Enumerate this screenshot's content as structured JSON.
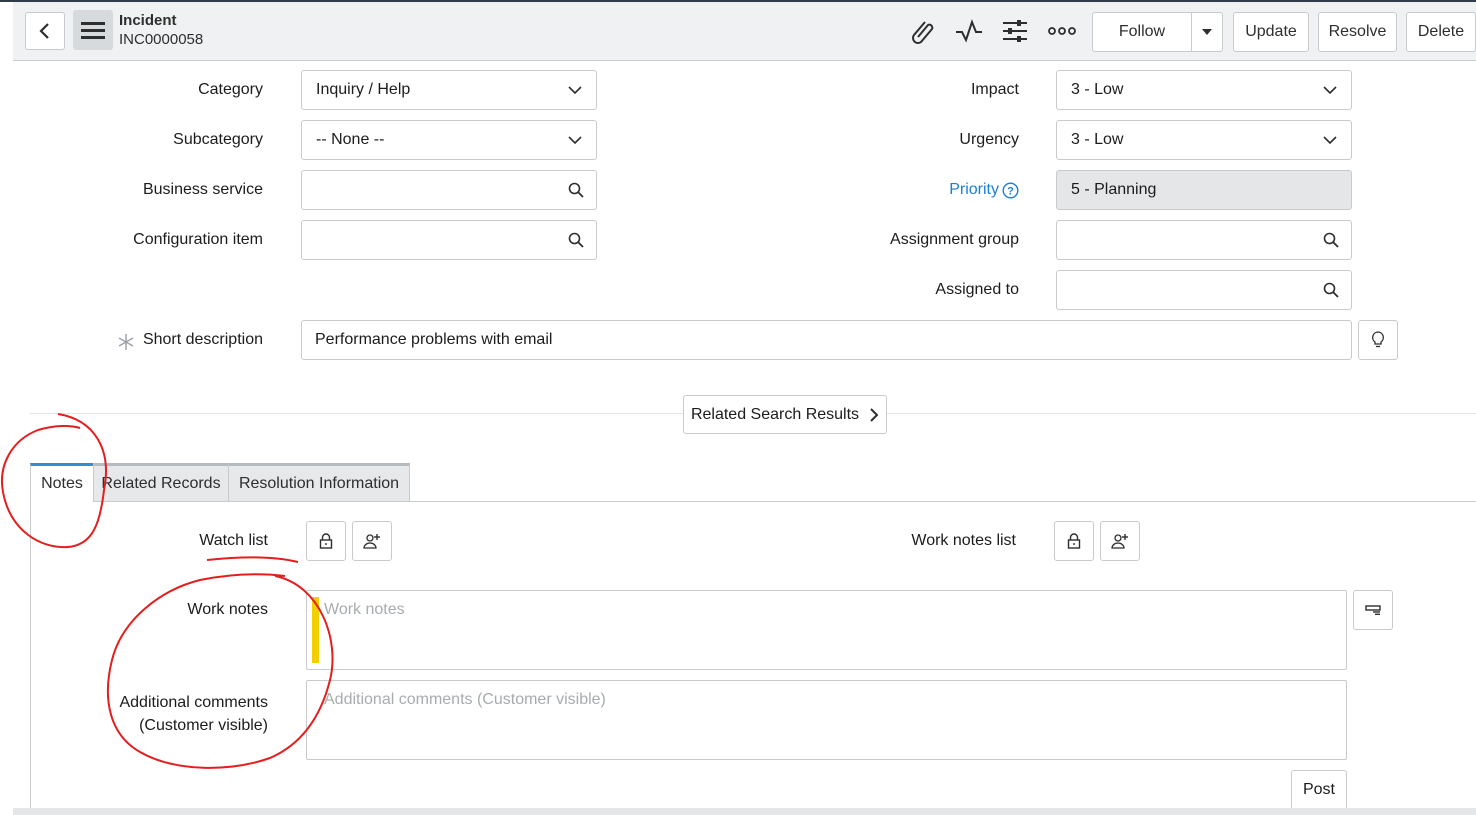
{
  "header": {
    "title": "Incident",
    "number": "INC0000058",
    "follow_label": "Follow",
    "update_label": "Update",
    "resolve_label": "Resolve",
    "delete_label": "Delete",
    "icons": [
      "back-icon",
      "hamburger-menu-icon",
      "paperclip-icon",
      "activity-icon",
      "sliders-icon",
      "more-options-icon",
      "caret-down-icon"
    ]
  },
  "form": {
    "category": {
      "label": "Category",
      "value": "Inquiry / Help"
    },
    "subcategory": {
      "label": "Subcategory",
      "value": "-- None --"
    },
    "business_service": {
      "label": "Business service",
      "value": ""
    },
    "configuration_item": {
      "label": "Configuration item",
      "value": ""
    },
    "impact": {
      "label": "Impact",
      "value": "3 - Low"
    },
    "urgency": {
      "label": "Urgency",
      "value": "3 - Low"
    },
    "priority": {
      "label": "Priority",
      "value": "5 - Planning"
    },
    "assignment_group": {
      "label": "Assignment group",
      "value": ""
    },
    "assigned_to": {
      "label": "Assigned to",
      "value": ""
    },
    "short_description": {
      "label": "Short description",
      "value": "Performance problems with email"
    }
  },
  "related_search": {
    "label": "Related Search Results"
  },
  "tabs": [
    {
      "label": "Notes",
      "active": true
    },
    {
      "label": "Related Records",
      "active": false
    },
    {
      "label": "Resolution Information",
      "active": false
    }
  ],
  "notes": {
    "watch_list_label": "Watch list",
    "work_notes_list_label": "Work notes list",
    "work_notes_label": "Work notes",
    "work_notes_placeholder": "Work notes",
    "additional_comments_label_1": "Additional comments",
    "additional_comments_label_2": "(Customer visible)",
    "additional_comments_placeholder": "Additional comments (Customer visible)",
    "post_label": "Post"
  },
  "colors": {
    "link": "#1a7fd6",
    "active_tab": "#2d8fd5",
    "annotation": "#e41e1e",
    "work_notes_marker": "#f2cf00"
  }
}
